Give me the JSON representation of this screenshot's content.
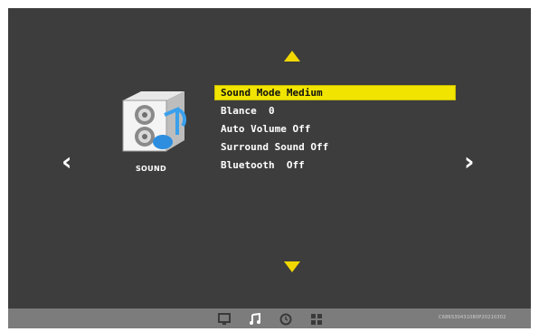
{
  "menu": {
    "category": "SOUND",
    "selected_index": 0,
    "items": [
      {
        "label": "Sound Mode Medium"
      },
      {
        "label": "Blance  0"
      },
      {
        "label": "Auto Volume Off"
      },
      {
        "label": "Surround Sound Off"
      },
      {
        "label": "Bluetooth  Off"
      }
    ]
  },
  "navigation": {
    "left_arrow": "‹",
    "right_arrow": "›"
  },
  "bottom_bar": {
    "icons": [
      "picture-icon",
      "music-note-icon",
      "clock-icon",
      "grid-icon"
    ],
    "model_code": "C686S30431080P20210302"
  },
  "colors": {
    "screen_bg": "#3d3d3d",
    "accent": "#f1e400",
    "bar_bg": "#7c7c7c"
  }
}
